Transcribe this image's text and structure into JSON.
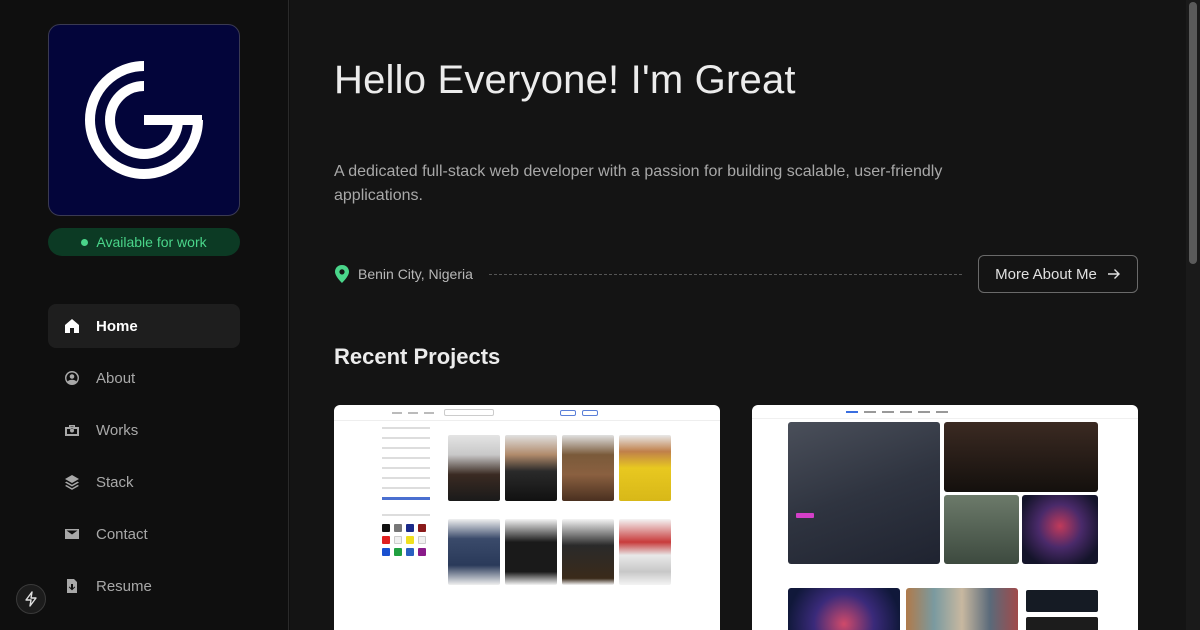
{
  "sidebar": {
    "availability": "Available  for work",
    "nav": [
      {
        "label": "Home",
        "icon": "home-icon",
        "active": true
      },
      {
        "label": "About",
        "icon": "user-circle-icon",
        "active": false
      },
      {
        "label": "Works",
        "icon": "briefcase-icon",
        "active": false
      },
      {
        "label": "Stack",
        "icon": "layers-icon",
        "active": false
      },
      {
        "label": "Contact",
        "icon": "mail-icon",
        "active": false
      },
      {
        "label": "Resume",
        "icon": "download-file-icon",
        "active": false
      }
    ]
  },
  "hero": {
    "title": "Hello Everyone! I'm Great",
    "description": "A dedicated full-stack web developer with a passion for building scalable, user-friendly applications.",
    "location": "Benin City, Nigeria",
    "more_button": "More About Me"
  },
  "projects": {
    "heading": "Recent Projects"
  },
  "colors": {
    "accent_green": "#4ad58a",
    "logo_bg": "#03053a",
    "page_bg": "#141414"
  }
}
